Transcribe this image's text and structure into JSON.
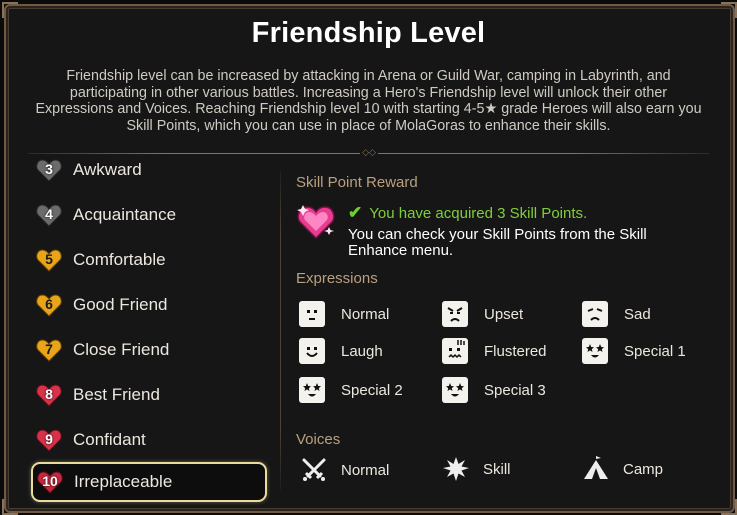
{
  "title": "Friendship Level",
  "description": "Friendship level can be increased by attacking in Arena or Guild War, camping in Labyrinth, and participating in other various battles. Increasing a Hero's Friendship level will unlock their other Expressions and Voices. Reaching Friendship level 10 with starting 4-5★ grade Heroes will also earn you Skill Points, which you can use in place of MolaGoras to enhance their skills.",
  "levels": [
    {
      "num": "3",
      "label": "Awkward",
      "color": "#6b6b6b"
    },
    {
      "num": "4",
      "label": "Acquaintance",
      "color": "#6b6b6b"
    },
    {
      "num": "5",
      "label": "Comfortable",
      "color": "#e8a51a"
    },
    {
      "num": "6",
      "label": "Good Friend",
      "color": "#e8a51a"
    },
    {
      "num": "7",
      "label": "Close Friend",
      "color": "#e8a51a"
    },
    {
      "num": "8",
      "label": "Best Friend",
      "color": "#d8324a"
    },
    {
      "num": "9",
      "label": "Confidant",
      "color": "#d8324a"
    },
    {
      "num": "10",
      "label": "Irreplaceable",
      "color": "#c8283e"
    }
  ],
  "selected_level": "10",
  "skill_point_reward": {
    "heading": "Skill Point Reward",
    "acquired": "You have acquired 3 Skill Points.",
    "note": "You can check your Skill Points from the Skill Enhance menu."
  },
  "expressions": {
    "heading": "Expressions",
    "items": [
      {
        "label": "Normal",
        "icon": "face-normal-icon"
      },
      {
        "label": "Upset",
        "icon": "face-upset-icon"
      },
      {
        "label": "Sad",
        "icon": "face-sad-icon"
      },
      {
        "label": "Laugh",
        "icon": "face-laugh-icon"
      },
      {
        "label": "Flustered",
        "icon": "face-flustered-icon"
      },
      {
        "label": "Special 1",
        "icon": "face-special-icon"
      },
      {
        "label": "Special 2",
        "icon": "face-special-icon"
      },
      {
        "label": "Special 3",
        "icon": "face-special-icon"
      }
    ]
  },
  "voices": {
    "heading": "Voices",
    "items": [
      {
        "label": "Normal",
        "icon": "crossed-swords-icon"
      },
      {
        "label": "Skill",
        "icon": "burst-icon"
      },
      {
        "label": "Camp",
        "icon": "tent-icon"
      }
    ]
  },
  "colors": {
    "accent_gold": "#e9dc9e",
    "reward_green": "#7fcf3a",
    "section_heading": "#b9a07f"
  }
}
